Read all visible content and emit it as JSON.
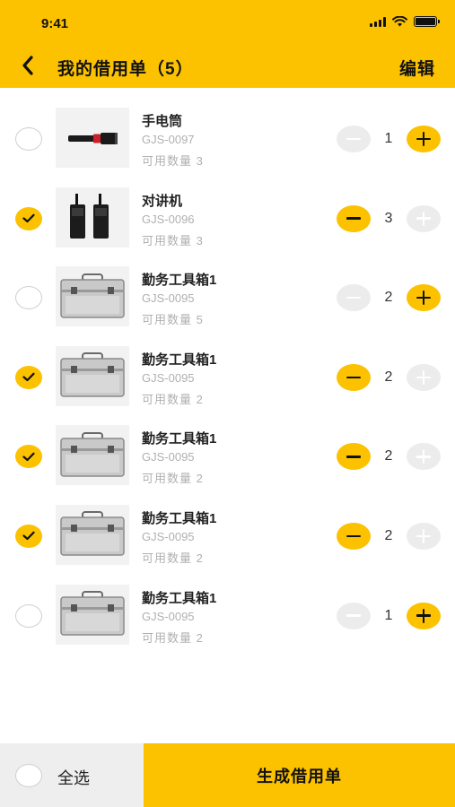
{
  "status_bar": {
    "time": "9:41"
  },
  "header": {
    "title": "我的借用单（5）",
    "edit_label": "编辑",
    "back_icon": "chevron-left-icon"
  },
  "colors": {
    "accent": "#FCC200",
    "muted_text": "#B0B0B0",
    "disabled": "#ECECEC"
  },
  "items": [
    {
      "name": "手电筒",
      "code": "GJS-0097",
      "available": "可用数量 3",
      "qty": "1",
      "checked": false,
      "image": "flashlight"
    },
    {
      "name": "对讲机",
      "code": "GJS-0096",
      "available": "可用数量 3",
      "qty": "3",
      "checked": true,
      "image": "walkie-talkie"
    },
    {
      "name": "勤务工具箱1",
      "code": "GJS-0095",
      "available": "可用数量 5",
      "qty": "2",
      "checked": false,
      "image": "toolbox"
    },
    {
      "name": "勤务工具箱1",
      "code": "GJS-0095",
      "available": "可用数量 2",
      "qty": "2",
      "checked": true,
      "image": "toolbox"
    },
    {
      "name": "勤务工具箱1",
      "code": "GJS-0095",
      "available": "可用数量 2",
      "qty": "2",
      "checked": true,
      "image": "toolbox"
    },
    {
      "name": "勤务工具箱1",
      "code": "GJS-0095",
      "available": "可用数量 2",
      "qty": "2",
      "checked": true,
      "image": "toolbox"
    },
    {
      "name": "勤务工具箱1",
      "code": "GJS-0095",
      "available": "可用数量 2",
      "qty": "1",
      "checked": false,
      "image": "toolbox"
    }
  ],
  "footer": {
    "select_all_label": "全选",
    "generate_label": "生成借用单"
  }
}
